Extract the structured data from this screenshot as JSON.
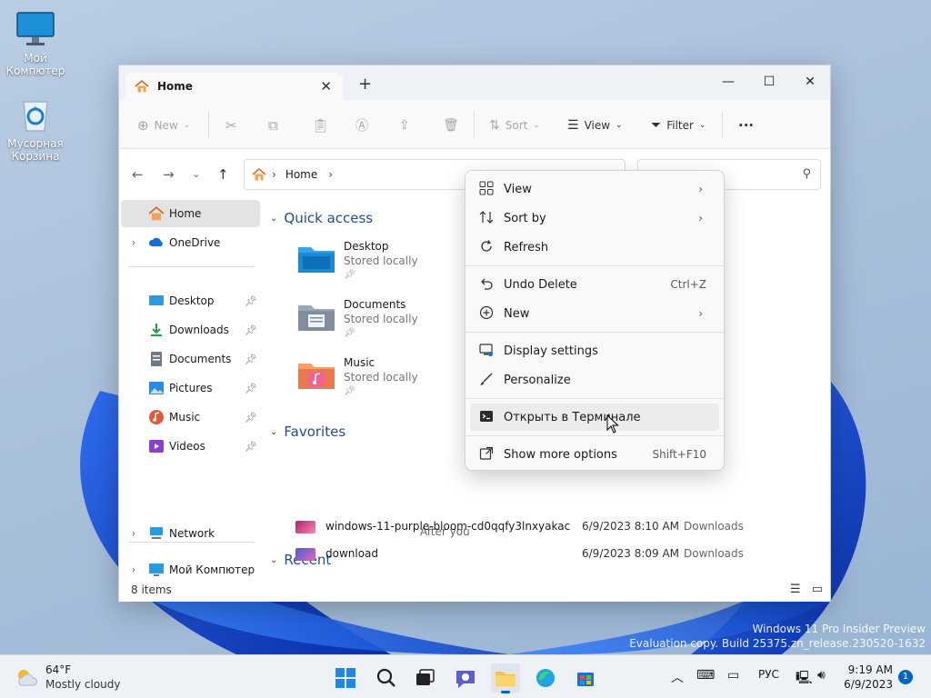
{
  "desktop": {
    "icons": [
      {
        "label": "Мой Компютер"
      },
      {
        "label": "Мусорная Корзина"
      }
    ]
  },
  "window": {
    "tab_title": "Home",
    "toolbar": {
      "new_label": "New",
      "sort_label": "Sort",
      "view_label": "View",
      "filter_label": "Filter",
      "more_label": "···"
    },
    "address": {
      "crumb": "Home"
    }
  },
  "nav": {
    "home": "Home",
    "onedrive": "OneDrive",
    "desktop": "Desktop",
    "downloads": "Downloads",
    "documents": "Documents",
    "pictures": "Pictures",
    "music": "Music",
    "videos": "Videos",
    "this_pc": "Мой Компютер",
    "network": "Network"
  },
  "content": {
    "quick_access_title": "Quick access",
    "quick_access": [
      {
        "name": "Desktop",
        "sub": "Stored locally"
      },
      {
        "name": "Documents",
        "sub": "Stored locally"
      },
      {
        "name": "Music",
        "sub": "Stored locally"
      }
    ],
    "favorites_title": "Favorites",
    "favorites_hint": "After you",
    "recent_title": "Recent",
    "recent": [
      {
        "name": "windows-11-purple-bloom-cd0qqfy3lnxyakac",
        "date": "6/9/2023 8:10 AM",
        "location": "Downloads"
      },
      {
        "name": "download",
        "date": "6/9/2023 8:09 AM",
        "location": "Downloads"
      }
    ]
  },
  "status": {
    "items_count": "8 items"
  },
  "context_menu": {
    "view": "View",
    "sort_by": "Sort by",
    "refresh": "Refresh",
    "undo_delete": "Undo Delete",
    "undo_shortcut": "Ctrl+Z",
    "new": "New",
    "display_settings": "Display settings",
    "personalize": "Personalize",
    "open_terminal": "Открыть в Терминале",
    "show_more": "Show more options",
    "show_more_shortcut": "Shift+F10"
  },
  "watermark": {
    "line1": "Windows 11 Pro Insider Preview",
    "line2": "Evaluation copy. Build 25375.zn_release.230520-1632"
  },
  "taskbar": {
    "weather_temp": "64°F",
    "weather_cond": "Mostly cloudy",
    "lang": "РУС",
    "time": "9:19 AM",
    "date": "6/9/2023",
    "notification_count": "1"
  },
  "colors": {
    "accent": "#0067c0",
    "section_text": "#1f4e8a"
  }
}
